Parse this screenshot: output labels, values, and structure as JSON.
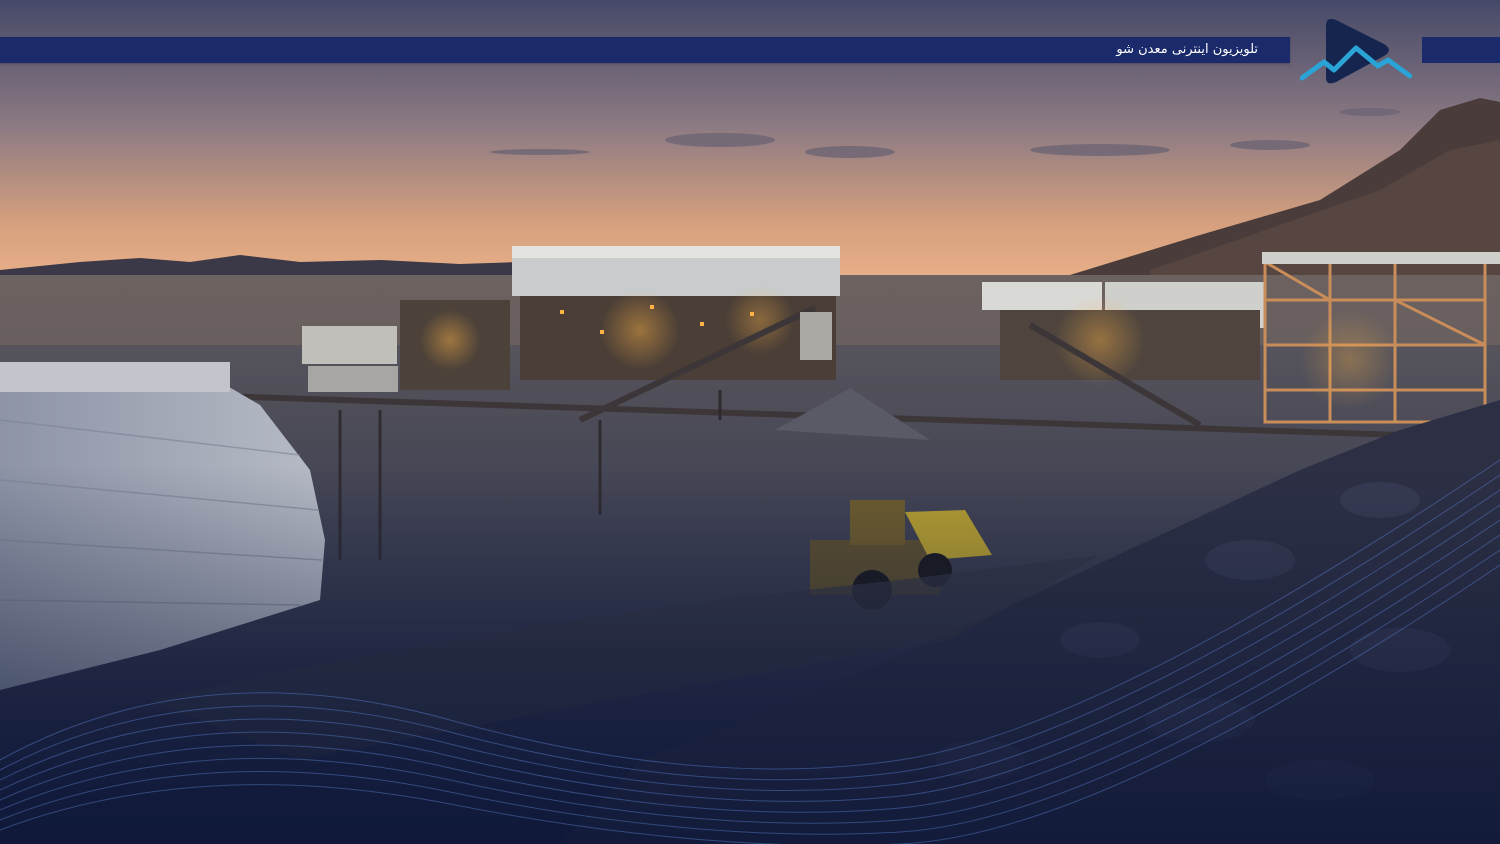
{
  "banner": {
    "channel_name": "تلویزیون اینترنی معدن شو"
  },
  "logo": {
    "icon": "play-mountain-logo",
    "colors": {
      "dark": "#16254f",
      "accent": "#2aa3d6"
    }
  },
  "colors": {
    "banner": "#1b2a6b",
    "sky_top": "#4b4f6e",
    "sky_horizon": "#e0a27a",
    "ground": "#2a2f44"
  }
}
